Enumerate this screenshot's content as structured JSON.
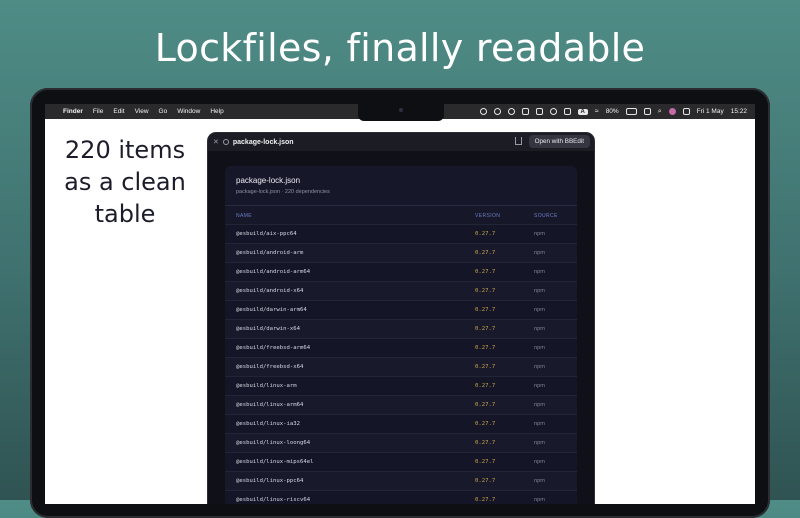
{
  "headline": "Lockfiles, finally readable",
  "side_text": [
    "220 items",
    "as a clean",
    "table"
  ],
  "menubar": {
    "items": [
      "Finder",
      "File",
      "Edit",
      "View",
      "Go",
      "Window",
      "Help"
    ],
    "input_source": "A",
    "battery": "80%",
    "date": "Fri 1 May",
    "time": "15:22"
  },
  "window": {
    "title": "package-lock.json",
    "open_button": "Open with BBEdit"
  },
  "panel": {
    "title": "package-lock.json",
    "subtitle": "package-lock.json · 220 dependencies",
    "columns": [
      "NAME",
      "VERSION",
      "SOURCE"
    ],
    "rows": [
      {
        "name": "@esbuild/aix-ppc64",
        "version": "0.27.7",
        "source": "npm"
      },
      {
        "name": "@esbuild/android-arm",
        "version": "0.27.7",
        "source": "npm"
      },
      {
        "name": "@esbuild/android-arm64",
        "version": "0.27.7",
        "source": "npm"
      },
      {
        "name": "@esbuild/android-x64",
        "version": "0.27.7",
        "source": "npm"
      },
      {
        "name": "@esbuild/darwin-arm64",
        "version": "0.27.7",
        "source": "npm"
      },
      {
        "name": "@esbuild/darwin-x64",
        "version": "0.27.7",
        "source": "npm"
      },
      {
        "name": "@esbuild/freebsd-arm64",
        "version": "0.27.7",
        "source": "npm"
      },
      {
        "name": "@esbuild/freebsd-x64",
        "version": "0.27.7",
        "source": "npm"
      },
      {
        "name": "@esbuild/linux-arm",
        "version": "0.27.7",
        "source": "npm"
      },
      {
        "name": "@esbuild/linux-arm64",
        "version": "0.27.7",
        "source": "npm"
      },
      {
        "name": "@esbuild/linux-ia32",
        "version": "0.27.7",
        "source": "npm"
      },
      {
        "name": "@esbuild/linux-loong64",
        "version": "0.27.7",
        "source": "npm"
      },
      {
        "name": "@esbuild/linux-mips64el",
        "version": "0.27.7",
        "source": "npm"
      },
      {
        "name": "@esbuild/linux-ppc64",
        "version": "0.27.7",
        "source": "npm"
      },
      {
        "name": "@esbuild/linux-riscv64",
        "version": "0.27.7",
        "source": "npm"
      }
    ]
  }
}
